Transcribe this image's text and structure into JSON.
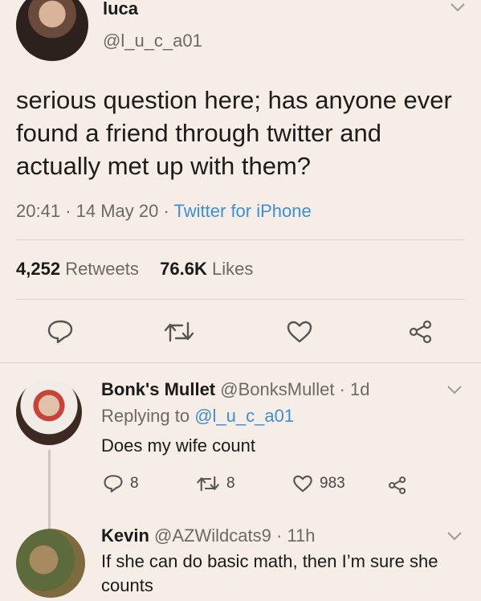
{
  "main_tweet": {
    "author_name": "luca",
    "author_handle": "@l_u_c_a01",
    "text": "serious question here; has anyone ever found a friend through twitter and actually met up with them?",
    "time": "20:41",
    "date": "14 May 20",
    "source": "Twitter for iPhone",
    "retweets_count": "4,252",
    "retweets_label": "Retweets",
    "likes_count": "76.6K",
    "likes_label": "Likes"
  },
  "replies": [
    {
      "author_name": "Bonk's Mullet",
      "author_handle": "@BonksMullet",
      "age": "1d",
      "replying_prefix": "Replying to",
      "replying_to": "@l_u_c_a01",
      "text": "Does my wife count",
      "reply_count": "8",
      "retweet_count": "8",
      "like_count": "983"
    },
    {
      "author_name": "Kevin",
      "author_handle": "@AZWildcats9",
      "age": "11h",
      "text": "If she can do basic math, then I’m sure she counts"
    }
  ],
  "separators": {
    "dot": "·"
  },
  "icons": {
    "reply": "reply-icon",
    "retweet": "retweet-icon",
    "like": "heart-icon",
    "share": "share-icon",
    "more": "chevron-down-icon"
  },
  "colors": {
    "link": "#3b8fd6",
    "background": "#f6eee6",
    "muted": "#6c6864"
  }
}
